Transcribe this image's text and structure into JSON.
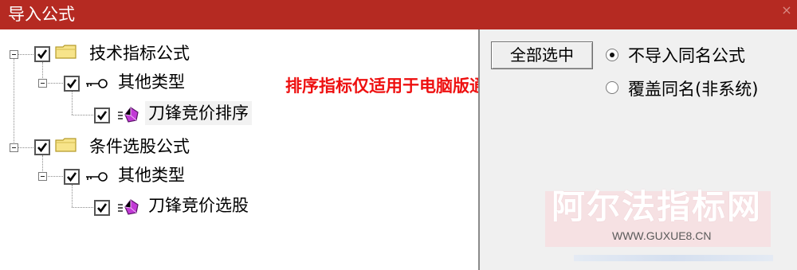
{
  "window": {
    "title": "导入公式",
    "close_glyph": "×",
    "title_bar_color": "#b52a22"
  },
  "tree": {
    "nodes": [
      {
        "label": "技术指标公式",
        "icon": "folder-icon",
        "checked": true,
        "expanded": true
      },
      {
        "label": "其他类型",
        "icon": "key-icon",
        "checked": true,
        "expanded": true
      },
      {
        "label": "刀锋竞价排序",
        "icon": "gem-icon",
        "checked": true,
        "selected": true
      },
      {
        "label": "条件选股公式",
        "icon": "folder-icon",
        "checked": true,
        "expanded": true
      },
      {
        "label": "其他类型",
        "icon": "key-icon",
        "checked": true,
        "expanded": true
      },
      {
        "label": "刀锋竞价选股",
        "icon": "gem-icon",
        "checked": true
      }
    ]
  },
  "annotation": {
    "text": "排序指标仅适用于电脑版通达信",
    "color": "#ee1010"
  },
  "options": {
    "select_all_label": "全部选中",
    "radios": [
      {
        "label": "不导入同名公式",
        "selected": true
      },
      {
        "label": "覆盖同名(非系统)",
        "selected": false
      }
    ]
  },
  "watermark": {
    "title": "阿尔法指标网",
    "url": "WWW.GUXUE8.CN"
  }
}
